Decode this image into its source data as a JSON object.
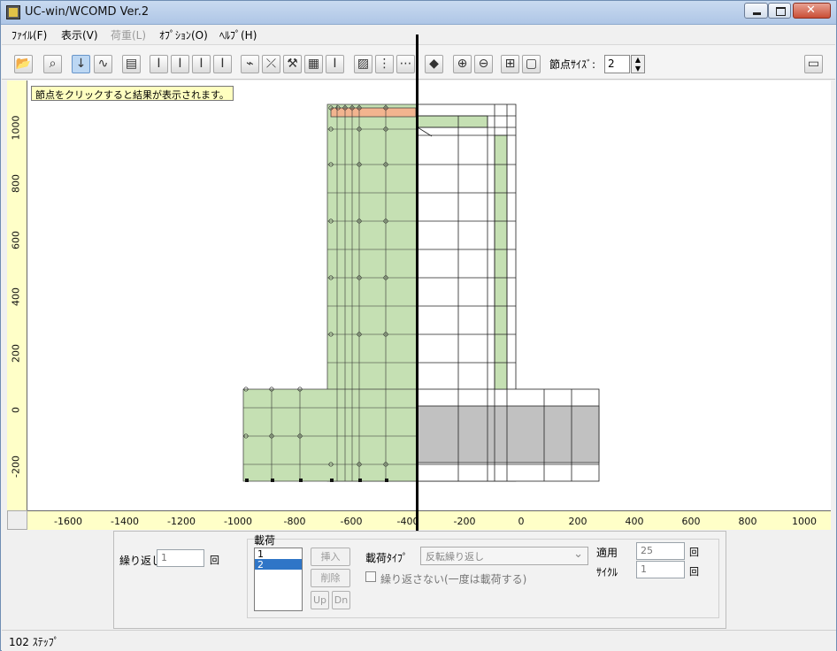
{
  "window": {
    "title": "UC-win/WCOMD Ver.2"
  },
  "menu": {
    "items": [
      {
        "label": "ﾌｧｲﾙ(F)",
        "enabled": true
      },
      {
        "label": "表示(V)",
        "enabled": true
      },
      {
        "label": "荷重(L)",
        "enabled": false
      },
      {
        "label": "ｵﾌﾟｼｮﾝ(O)",
        "enabled": true
      },
      {
        "label": "ﾍﾙﾌﾟ(H)",
        "enabled": true
      }
    ]
  },
  "toolbar": {
    "node_size_label": "節点ｻｲｽﾞ:",
    "node_size_value": "2"
  },
  "hint": "節点をクリックすると結果が表示されます。",
  "rulers": {
    "vertical_ticks": [
      "1000",
      "800",
      "600",
      "400",
      "200",
      "0",
      "-200"
    ],
    "horizontal_ticks": [
      "-1600",
      "-1400",
      "-1200",
      "-1000",
      "-800",
      "-600",
      "-400",
      "-200",
      "0",
      "200",
      "400",
      "600",
      "800",
      "1000"
    ]
  },
  "bottom_panel": {
    "repeat_label": "繰り返し",
    "repeat_value": "1",
    "load_group_label": "載荷",
    "load_items": [
      "1",
      "2"
    ],
    "selected_load_index": 1,
    "insert_button": "挿入",
    "delete_button": "削除",
    "up_button": "Up",
    "down_button": "Dn",
    "load_type_label": "載荷ﾀｲﾌﾟ",
    "load_type_value": "反転繰り返し",
    "no_repeat_label": "繰り返さない(一度は載荷する)",
    "apply_label": "適用",
    "apply_value": "25",
    "cycle_label": "ｻｲｸﾙ",
    "cycle_value": "1",
    "unit_label_1": "回",
    "unit_label_2": "回",
    "unit_label_3": "回"
  },
  "status": {
    "text": "102 ｽﾃｯﾌﾟ"
  },
  "colors": {
    "green_fill": "#c5e0b3",
    "orange_fill": "#f2b48f",
    "gray_fill": "#c1c1c1",
    "ruler_fill": "#ffffc8"
  }
}
